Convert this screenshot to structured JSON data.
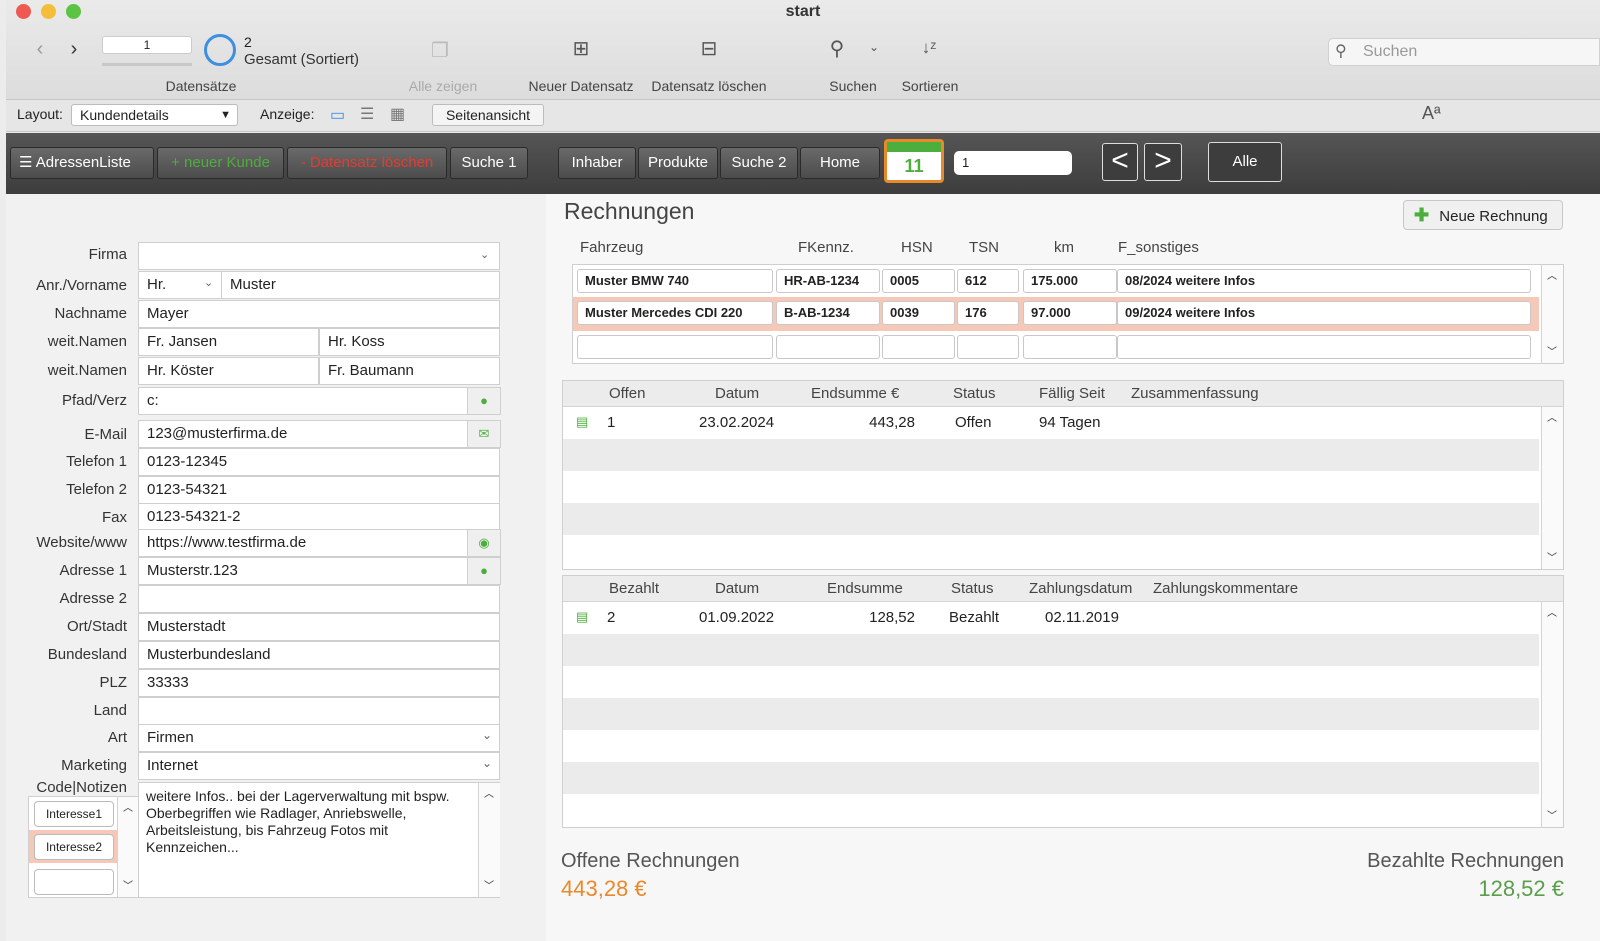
{
  "window": {
    "title": "start"
  },
  "toolbar": {
    "record_current": "1",
    "record_count": "2",
    "record_status": "Gesamt (Sortiert)",
    "records_label": "Datensätze",
    "show_all": "Alle zeigen",
    "new_record": "Neuer Datensatz",
    "delete_record": "Datensatz löschen",
    "find": "Suchen",
    "sort": "Sortieren",
    "search_placeholder": "Suchen"
  },
  "layoutbar": {
    "layout_label": "Layout:",
    "layout_value": "Kundendetails",
    "view_label": "Anzeige:",
    "preview": "Seitenansicht"
  },
  "navbar": {
    "address_list": "AdressenListe",
    "new_customer": "+ neuer Kunde",
    "delete_record": "- Datensatz löschen",
    "search1": "Suche 1",
    "owner": "Inhaber",
    "products": "Produkte",
    "search2": "Suche 2",
    "home": "Home",
    "calendar_day": "11",
    "page_field": "1",
    "prev": "<",
    "next": ">",
    "all": "Alle"
  },
  "form": {
    "labels": {
      "firma": "Firma",
      "anrede": "Anr./Vorname",
      "nachname": "Nachname",
      "weit1": "weit.Namen",
      "weit2": "weit.Namen",
      "pfad": "Pfad/Verz",
      "email": "E-Mail",
      "tel1": "Telefon 1",
      "tel2": "Telefon 2",
      "fax": "Fax",
      "web": "Website/www",
      "adr1": "Adresse 1",
      "adr2": "Adresse 2",
      "ort": "Ort/Stadt",
      "bundesland": "Bundesland",
      "plz": "PLZ",
      "land": "Land",
      "art": "Art",
      "marketing": "Marketing",
      "code": "Code|Notizen"
    },
    "values": {
      "firma": "",
      "anrede": "Hr.",
      "vorname": "Muster",
      "nachname": "Mayer",
      "weit1a": "Fr. Jansen",
      "weit1b": "Hr. Koss",
      "weit2a": "Hr. Köster",
      "weit2b": "Fr. Baumann",
      "pfad": "c:",
      "email": "123@musterfirma.de",
      "tel1": "0123-12345",
      "tel2": "0123-54321",
      "fax": "0123-54321-2",
      "web": "https://www.testfirma.de",
      "adr1": "Musterstr.123",
      "adr2": "",
      "ort": "Musterstadt",
      "bundesland": "Musterbundesland",
      "plz": "33333",
      "land": "",
      "art": "Firmen",
      "marketing": "Internet"
    },
    "interests": [
      "Interesse1",
      "Interesse2",
      ""
    ],
    "notes": "weitere Infos.. bei der Lagerverwaltung mit bspw. Oberbegriffen wie Radlager, Anriebswelle, Arbeitsleistung, bis Fahrzeug Fotos mit Kennzeichen..."
  },
  "invoices": {
    "title": "Rechnungen",
    "new_invoice": "Neue Rechnung",
    "vehicle_headers": [
      "Fahrzeug",
      "FKennz.",
      "HSN",
      "TSN",
      "km",
      "F_sonstiges"
    ],
    "vehicles": [
      [
        "Muster BMW 740",
        "HR-AB-1234",
        "0005",
        "612",
        "175.000",
        "08/2024 weitere Infos"
      ],
      [
        "Muster Mercedes CDI 220",
        "B-AB-1234",
        "0039",
        "176",
        "97.000",
        "09/2024 weitere Infos"
      ]
    ],
    "open_headers": [
      "Offen",
      "Datum",
      "Endsumme  €",
      "Status",
      "Fällig Seit",
      "Zusammenfassung"
    ],
    "open_rows": [
      [
        "1",
        "23.02.2024",
        "443,28",
        "Offen",
        "94 Tagen",
        ""
      ]
    ],
    "paid_headers": [
      "Bezahlt",
      "Datum",
      "Endsumme",
      "Status",
      "Zahlungsdatum",
      "Zahlungskommentare"
    ],
    "paid_rows": [
      [
        "2",
        "01.09.2022",
        "128,52",
        "Bezahlt",
        "02.11.2019",
        ""
      ]
    ],
    "open_total_label": "Offene Rechnungen",
    "open_total": "443,28 €",
    "paid_total_label": "Bezahlte Rechnungen",
    "paid_total": "128,52 €"
  },
  "colors": {
    "accent_green": "#4cae3c",
    "accent_red": "#e83a2f",
    "open_total": "#e8892a",
    "paid_total": "#5a9e4c",
    "highlight_row": "#f5c8b8"
  }
}
